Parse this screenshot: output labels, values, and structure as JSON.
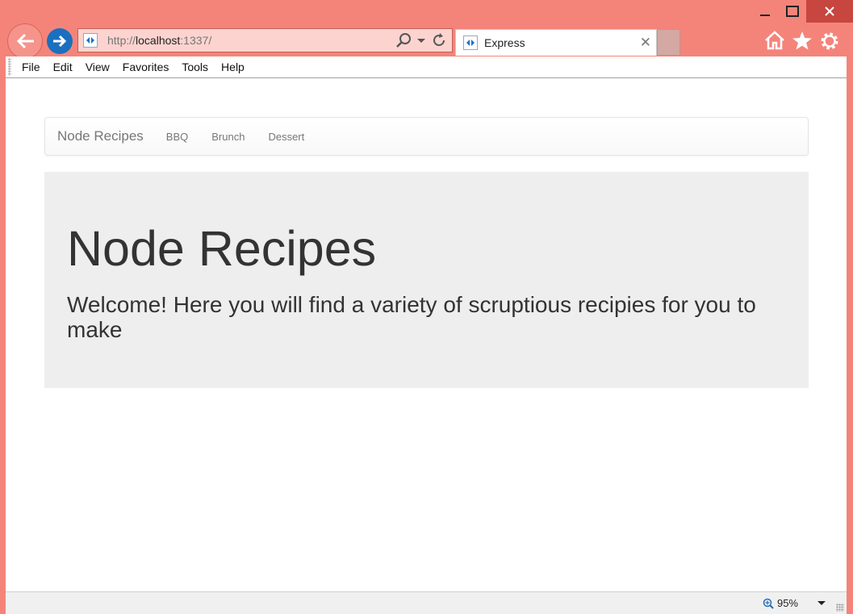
{
  "browser": {
    "address": {
      "prefix": "http://",
      "host": "localhost",
      "suffix": ":1337/"
    },
    "tab": {
      "title": "Express"
    },
    "menu": [
      "File",
      "Edit",
      "View",
      "Favorites",
      "Tools",
      "Help"
    ],
    "zoom": "95%",
    "colors": {
      "frame": "#f4847a",
      "close": "#c7463f",
      "forward": "#1b6fbf"
    }
  },
  "page": {
    "navbar": {
      "brand": "Node Recipes",
      "links": [
        "BBQ",
        "Brunch",
        "Dessert"
      ]
    },
    "jumbotron": {
      "title": "Node Recipes",
      "text": "Welcome! Here you will find a variety of scruptious recipies for you to make"
    }
  },
  "icons": {
    "window": [
      "minimize-icon",
      "maximize-icon",
      "close-icon"
    ],
    "toolbar": [
      "back-arrow-icon",
      "forward-arrow-icon",
      "site-favicon",
      "search-icon",
      "dropdown-icon",
      "refresh-icon",
      "home-icon",
      "favorites-star-icon",
      "settings-gear-icon",
      "zoom-icon"
    ]
  }
}
